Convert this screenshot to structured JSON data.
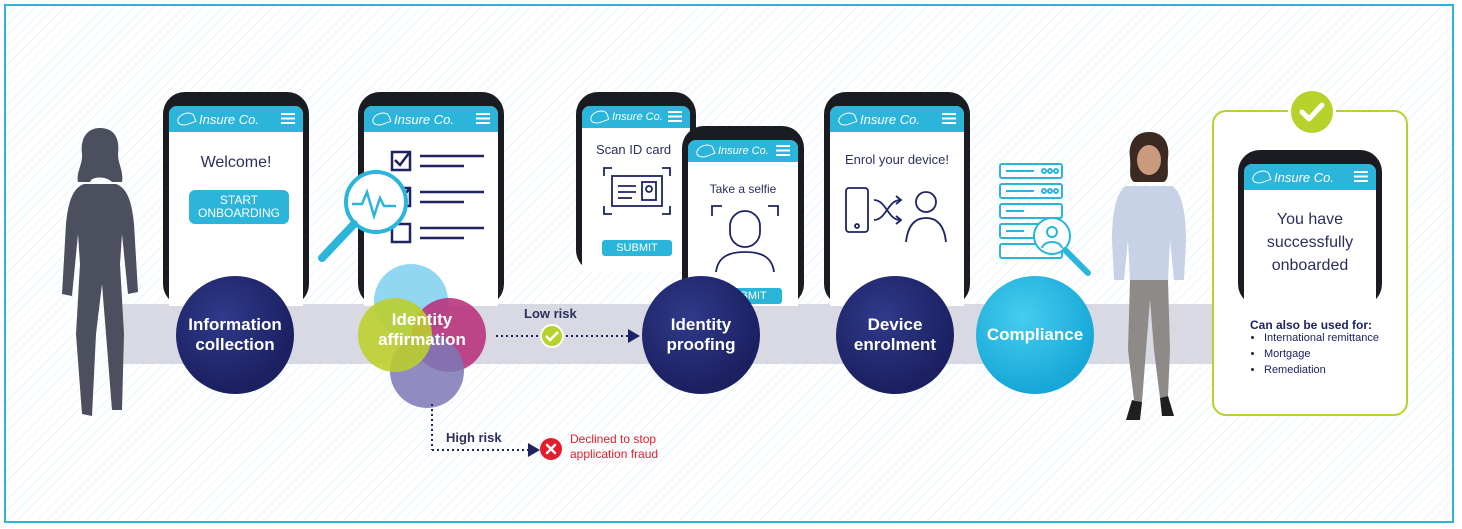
{
  "brand": "Insure Co.",
  "colors": {
    "cyan": "#2bb5da",
    "navy": "#1d2363",
    "lime": "#b8d22c",
    "red": "#e31d2b",
    "band": "#d8d9e2"
  },
  "phone1": {
    "welcome": "Welcome!",
    "button": "START\nONBOARDING"
  },
  "phone3": {
    "title": "Scan ID card",
    "button": "SUBMIT"
  },
  "phone4": {
    "title": "Take a selfie",
    "button": "SUBMIT"
  },
  "phone5": {
    "title": "Enrol your device!"
  },
  "phone6": {
    "message": "You have\nsuccessfully\nonboarded"
  },
  "steps": {
    "info": "Information\ncollection",
    "affirm": "Identity\naffirmation",
    "proofing": "Identity\nproofing",
    "device": "Device\nenrolment",
    "compliance": "Compliance"
  },
  "low_risk": "Low risk",
  "high_risk": "High risk",
  "declined": "Declined to stop\napplication fraud",
  "also": {
    "title": "Can also be used for:",
    "items": [
      "International remittance",
      "Mortgage",
      "Remediation"
    ]
  },
  "icons": [
    "woman-silhouette-icon",
    "magnifier-pulse-icon",
    "checklist-icon",
    "id-card-icon",
    "selfie-icon",
    "device-transfer-icon",
    "server-search-icon",
    "check-badge-icon",
    "cross-icon"
  ]
}
